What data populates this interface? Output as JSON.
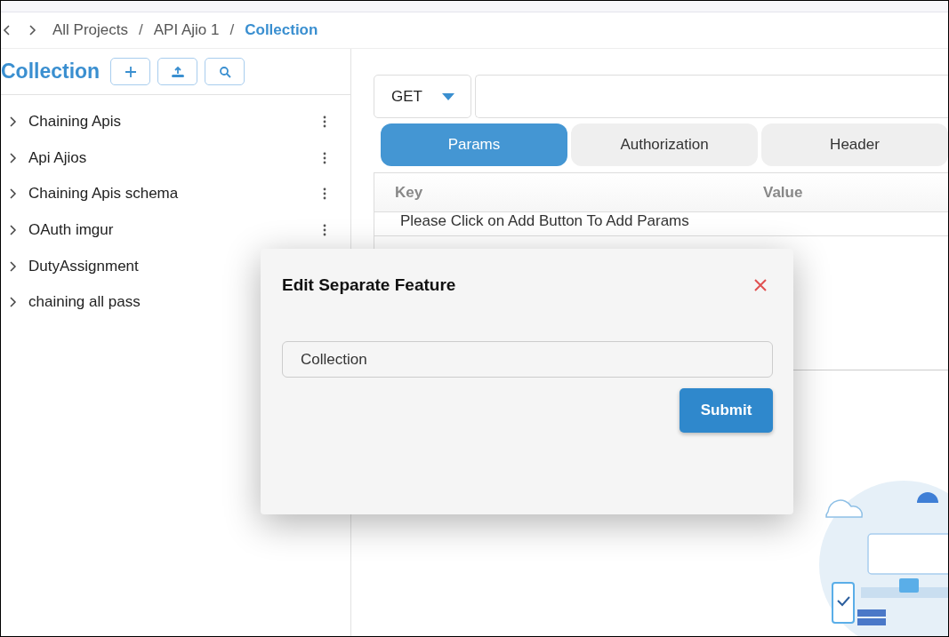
{
  "breadcrumb": {
    "items": [
      {
        "label": "All Projects",
        "selected": false
      },
      {
        "label": "API Ajio 1",
        "selected": false
      },
      {
        "label": "Collection",
        "selected": true
      }
    ],
    "separator": "/"
  },
  "sidebar": {
    "title": "Collection",
    "items": [
      {
        "label": "Chaining Apis",
        "expanded": false
      },
      {
        "label": "Api Ajios",
        "expanded": false
      },
      {
        "label": "Chaining Apis schema",
        "expanded": false
      },
      {
        "label": "OAuth imgur",
        "expanded": false
      },
      {
        "label": "DutyAssignment",
        "expanded": false
      },
      {
        "label": "chaining all pass",
        "expanded": false
      }
    ]
  },
  "request": {
    "method": "GET",
    "tabs": [
      {
        "label": "Params",
        "selected": true
      },
      {
        "label": "Authorization",
        "selected": false
      },
      {
        "label": "Header",
        "selected": false
      }
    ],
    "table": {
      "columns": [
        "Key",
        "Value"
      ],
      "empty_message": "Please Click on Add Button To Add Params"
    }
  },
  "modal": {
    "title": "Edit Separate Feature",
    "field_value": "Collection",
    "submit": "Submit"
  }
}
